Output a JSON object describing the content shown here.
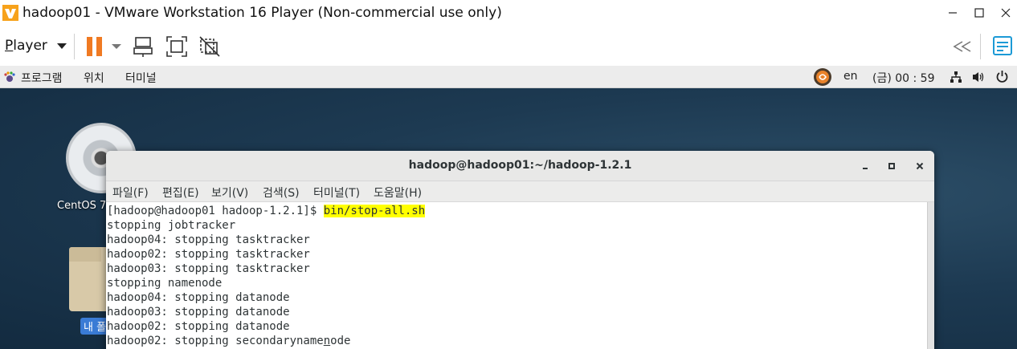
{
  "vm": {
    "title": "hadoop01 - VMware Workstation 16 Player (Non-commercial use only)",
    "player_first": "P",
    "player_rest": "layer"
  },
  "panel": {
    "applications": "프로그램",
    "places": "위치",
    "terminal": "터미널",
    "lang": "en",
    "clock": "(금) 00 : 59"
  },
  "desktop": {
    "cd_label": "CentOS 7",
    "folder_label": "내 폴"
  },
  "terminal": {
    "title": "hadoop@hadoop01:~/hadoop-1.2.1",
    "menus": [
      "파일(F)",
      "편집(E)",
      "보기(V)",
      "검색(S)",
      "터미널(T)",
      "도움말(H)"
    ],
    "prompt": "[hadoop@hadoop01 hadoop-1.2.1]$ ",
    "command": "bin/stop-all.sh",
    "output": [
      "stopping jobtracker",
      "hadoop04: stopping tasktracker",
      "hadoop02: stopping tasktracker",
      "hadoop03: stopping tasktracker",
      "stopping namenode",
      "hadoop04: stopping datanode",
      "hadoop03: stopping datanode",
      "hadoop02: stopping datanode"
    ],
    "last_line_a": "hadoop02: stopping secondaryname",
    "last_line_cursor": "n",
    "last_line_b": "ode"
  },
  "colors": {
    "highlight": "#ffff00",
    "pause": "#f07a22",
    "desktop": "#1d3a52"
  },
  "icons": [
    "vmware-logo-icon",
    "pause-icon",
    "send-ctrl-alt-del-icon",
    "fullscreen-icon",
    "unity-icon",
    "collapse-icon",
    "notes-icon",
    "gnome-foot-icon",
    "input-method-icon",
    "network-icon",
    "volume-icon",
    "power-icon"
  ]
}
